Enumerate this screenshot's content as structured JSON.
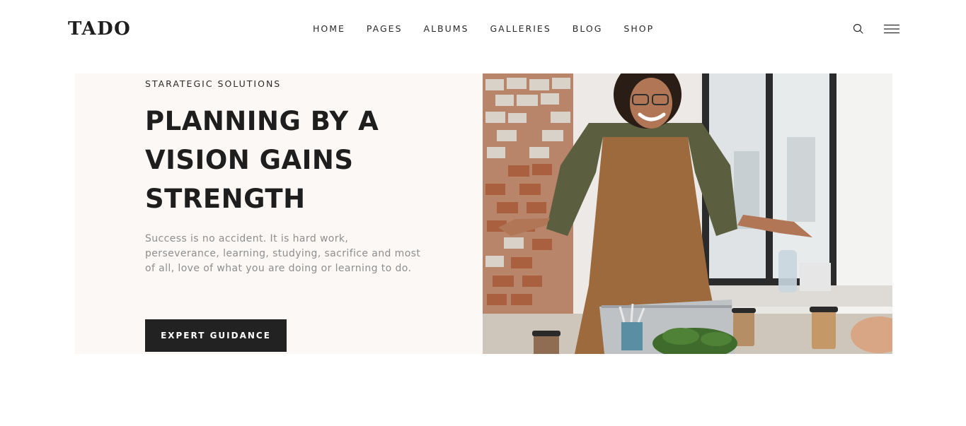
{
  "header": {
    "logo": "TADO",
    "nav": [
      "HOME",
      "PAGES",
      "ALBUMS",
      "GALLERIES",
      "BLOG",
      "SHOP"
    ],
    "icons": {
      "search": "search-icon",
      "menu": "hamburger-menu-icon"
    }
  },
  "hero": {
    "eyebrow": "STARATEGIC SOLUTIONS",
    "headline": "PLANNING BY A VISION GAINS STRENGTH",
    "body": "Success is no accident. It is hard work, perseverance, learning, studying, sacrifice and most of all, love of what you are doing or learning to do.",
    "cta_label": "EXPERT GUIDANCE"
  },
  "colors": {
    "text_dark": "#1e1e1e",
    "text_muted": "#8e8e8e",
    "hero_bg": "#fbf8f6",
    "button_bg": "#222222",
    "button_text": "#ffffff"
  }
}
